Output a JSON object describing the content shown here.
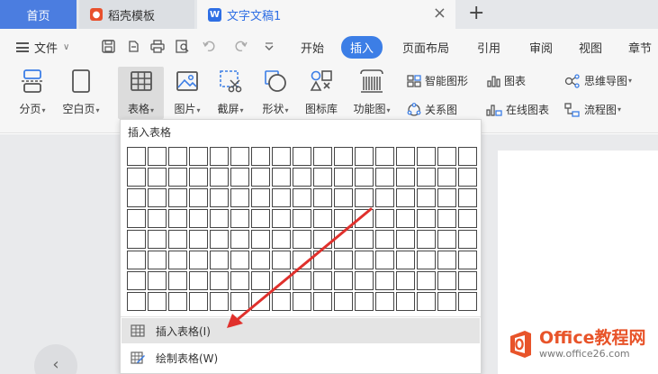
{
  "tabs": {
    "home": "首页",
    "template": "稻壳模板",
    "document": "文字文稿1",
    "add": "+"
  },
  "menubar": {
    "file_label": "文件",
    "tabs": [
      "开始",
      "插入",
      "页面布局",
      "引用",
      "审阅",
      "视图",
      "章节"
    ],
    "active_tab": "插入"
  },
  "ribbon": {
    "page_break": "分页",
    "blank_page": "空白页",
    "table": "表格",
    "picture": "图片",
    "screenshot": "截屏",
    "shapes": "形状",
    "icon_library": "图标库",
    "function_chart": "功能图",
    "smart_art": "智能图形",
    "chart": "图表",
    "mind_map": "思维导图",
    "relation_chart": "关系图",
    "online_chart": "在线图表",
    "flowchart": "流程图"
  },
  "dropdown": {
    "title": "插入表格",
    "grid_rows": 8,
    "grid_cols": 17,
    "insert_table": "插入表格(I)",
    "draw_table": "绘制表格(W)"
  },
  "watermark": {
    "brand": "Office教程网",
    "url": "www.office26.com"
  },
  "colors": {
    "accent": "#3c7ee6",
    "home_tab": "#4b7de0",
    "arrow": "#e0302c",
    "watermark": "#e8542a"
  }
}
